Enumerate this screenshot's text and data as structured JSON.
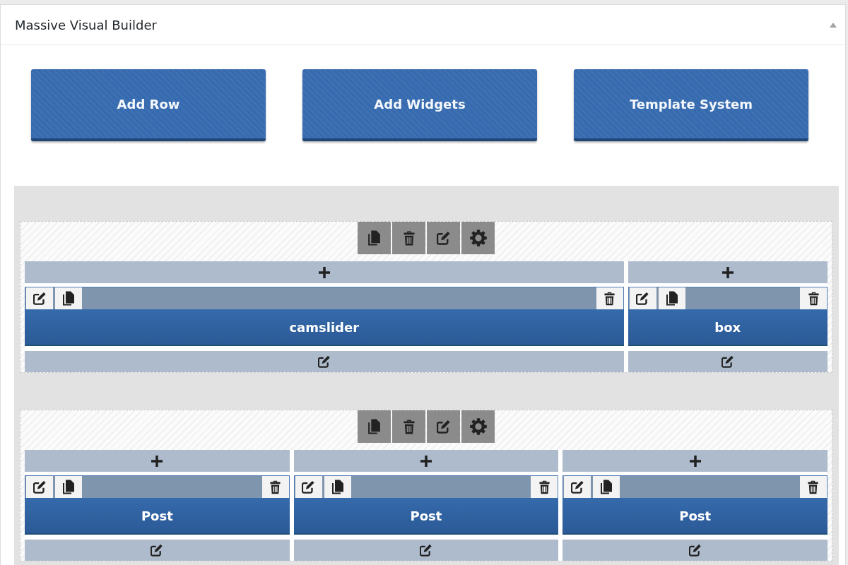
{
  "panel": {
    "title": "Massive Visual Builder"
  },
  "actions": [
    {
      "label": "Add Row"
    },
    {
      "label": "Add Widgets"
    },
    {
      "label": "Template System"
    }
  ],
  "rows": [
    {
      "columns": [
        {
          "widgets": [
            {
              "title": "camslider"
            }
          ]
        },
        {
          "widgets": [
            {
              "title": "box"
            }
          ]
        }
      ]
    },
    {
      "columns": [
        {
          "widgets": [
            {
              "title": "Post"
            }
          ]
        },
        {
          "widgets": [
            {
              "title": "Post"
            }
          ]
        },
        {
          "widgets": [
            {
              "title": "Post"
            }
          ]
        }
      ]
    }
  ]
}
